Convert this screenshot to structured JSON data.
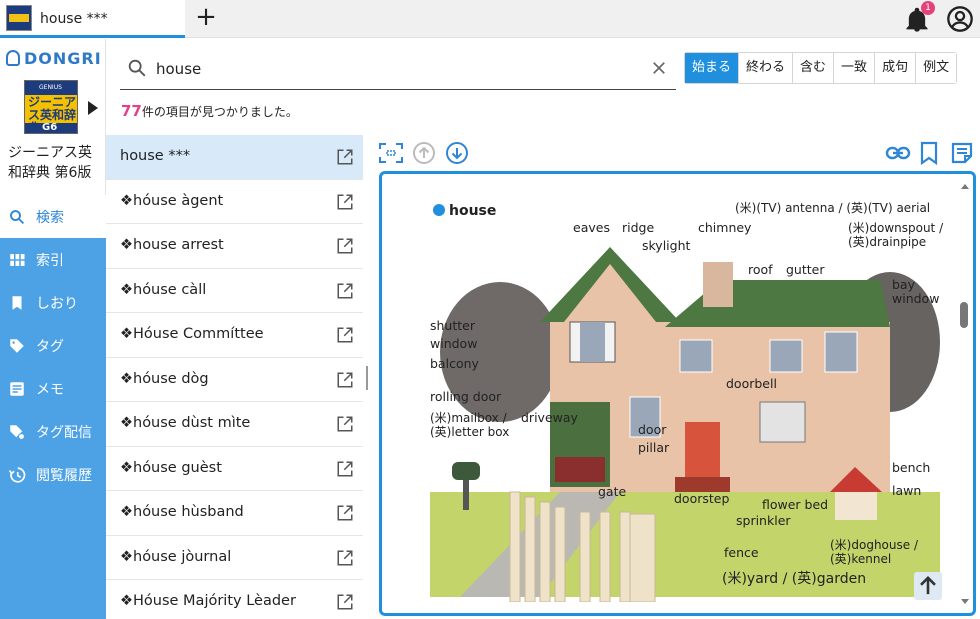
{
  "tab": {
    "title": "house ***",
    "new_tab": "+"
  },
  "notifications": {
    "count": "1"
  },
  "sidebar": {
    "logo": "DONGRI",
    "book_cover": {
      "genius": "GENIUS",
      "title": "ジーニアス英和辞典",
      "edition": "G6"
    },
    "dict_name": "ジーニアス英和辞典 第6版",
    "items": [
      {
        "label": "検索",
        "icon": "search-icon"
      },
      {
        "label": "索引",
        "icon": "grid-icon"
      },
      {
        "label": "しおり",
        "icon": "bookmark-icon"
      },
      {
        "label": "タグ",
        "icon": "tag-icon"
      },
      {
        "label": "メモ",
        "icon": "memo-icon"
      },
      {
        "label": "タグ配信",
        "icon": "tag-share-icon"
      },
      {
        "label": "閲覧履歴",
        "icon": "history-icon"
      }
    ]
  },
  "search": {
    "value": "house",
    "modes": [
      "始まる",
      "終わる",
      "含む",
      "一致",
      "成句",
      "例文"
    ],
    "active_mode": "始まる",
    "result_count": "77",
    "result_text": "件の項目が見つかりました。"
  },
  "results": [
    "house ***",
    "❖hóuse àgent",
    "❖house arrest",
    "❖hóuse càll",
    "❖Hóuse Commíttee",
    "❖hóuse dòg",
    "❖hóuse dùst mìte",
    "❖hóuse guèst",
    "❖hóuse hùsband",
    "❖hóuse jòurnal",
    "❖Hóuse Majórity Lèader"
  ],
  "illustration": {
    "title": "house",
    "labels": {
      "eaves": "eaves",
      "ridge": "ridge",
      "skylight": "skylight",
      "chimney": "chimney",
      "antenna": "(米)(TV) antenna / (英)(TV) aerial",
      "downspout": "(米)downspout /",
      "drainpipe": "(英)drainpipe",
      "roof": "roof",
      "gutter": "gutter",
      "bay": "bay",
      "window_bay": "window",
      "shutter": "shutter",
      "window": "window",
      "balcony": "balcony",
      "doorbell": "doorbell",
      "rolling_door": "rolling door",
      "mailbox": "(米)mailbox /",
      "letterbox": "(英)letter box",
      "driveway": "driveway",
      "door": "door",
      "pillar": "pillar",
      "bench": "bench",
      "gate": "gate",
      "doorstep": "doorstep",
      "flower_bed": "flower bed",
      "lawn": "lawn",
      "sprinkler": "sprinkler",
      "doghouse": "(米)doghouse /",
      "kennel": "(英)kennel",
      "fence": "fence",
      "yard": "(米)yard / (英)garden"
    }
  },
  "colors": {
    "accent": "#1f8fde",
    "sidebar": "#4da2e6",
    "count": "#e2418b",
    "selected_row": "#d8eaf9"
  }
}
